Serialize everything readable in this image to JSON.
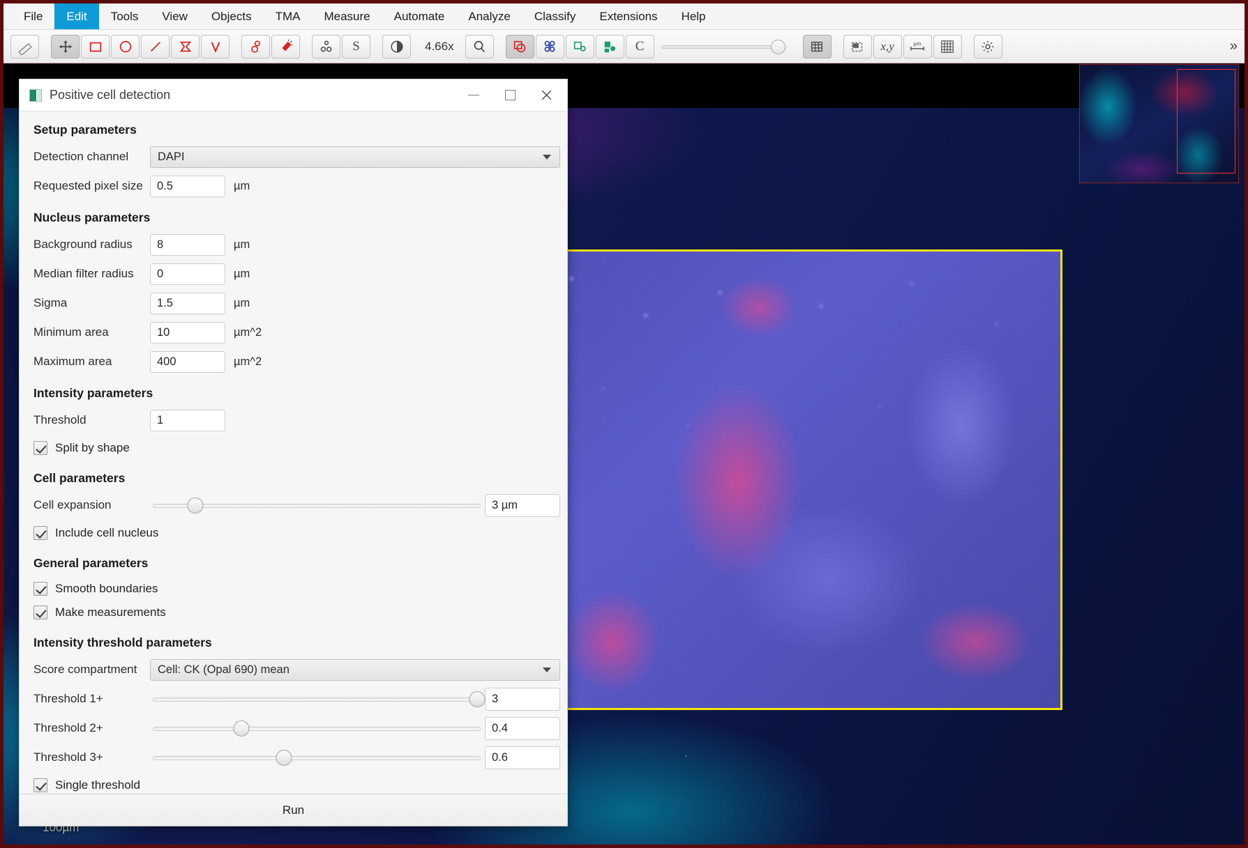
{
  "menubar": {
    "items": [
      {
        "label": "File",
        "active": false
      },
      {
        "label": "Edit",
        "active": true
      },
      {
        "label": "Tools",
        "active": false
      },
      {
        "label": "View",
        "active": false
      },
      {
        "label": "Objects",
        "active": false
      },
      {
        "label": "TMA",
        "active": false
      },
      {
        "label": "Measure",
        "active": false
      },
      {
        "label": "Automate",
        "active": false
      },
      {
        "label": "Analyze",
        "active": false
      },
      {
        "label": "Classify",
        "active": false
      },
      {
        "label": "Extensions",
        "active": false
      },
      {
        "label": "Help",
        "active": false
      }
    ]
  },
  "toolbar": {
    "zoom_label": "4.66x",
    "overflow_label": "»",
    "buttons": [
      {
        "name": "ruler-icon",
        "title": "Measure / ruler"
      },
      {
        "name": "move-tool-icon",
        "title": "Move tool"
      },
      {
        "name": "rectangle-tool-icon",
        "title": "Rectangle"
      },
      {
        "name": "ellipse-tool-icon",
        "title": "Ellipse"
      },
      {
        "name": "line-tool-icon",
        "title": "Line"
      },
      {
        "name": "polygon-tool-icon",
        "title": "Polygon"
      },
      {
        "name": "polyline-tool-icon",
        "title": "Polyline"
      },
      {
        "name": "brush-tool-icon",
        "title": "Brush"
      },
      {
        "name": "wand-tool-icon",
        "title": "Wand"
      },
      {
        "name": "points-tool-icon",
        "title": "Points"
      },
      {
        "name": "selection-mode-icon",
        "title": "S selection mode"
      },
      {
        "name": "brightness-contrast-icon",
        "title": "Brightness/contrast"
      },
      {
        "name": "magnifier-icon",
        "title": "Zoom to fit"
      },
      {
        "name": "show-annotations-icon",
        "title": "Show annotations"
      },
      {
        "name": "show-detections-icon",
        "title": "Show detections"
      },
      {
        "name": "fill-annotations-icon",
        "title": "Fill annotations"
      },
      {
        "name": "fill-detections-icon",
        "title": "Fill detections"
      },
      {
        "name": "show-classification-icon",
        "title": "Show classification"
      },
      {
        "name": "grid-icon",
        "title": "Show grid"
      },
      {
        "name": "overview-icon",
        "title": "Show overview"
      },
      {
        "name": "location-icon",
        "title": "Show location"
      },
      {
        "name": "scalebar-icon",
        "title": "Show scalebar"
      },
      {
        "name": "counting-grid-icon",
        "title": "Show counting grid"
      },
      {
        "name": "preferences-icon",
        "title": "Preferences"
      }
    ]
  },
  "dialog": {
    "title": "Positive cell detection",
    "window_controls": {
      "minimize": "—",
      "maximize": "☐",
      "close": "✕"
    },
    "sections": {
      "setup": {
        "title": "Setup parameters",
        "detection_channel": {
          "label": "Detection channel",
          "value": "DAPI"
        },
        "requested_pixel_size": {
          "label": "Requested pixel size",
          "value": "0.5",
          "unit": "µm"
        }
      },
      "nucleus": {
        "title": "Nucleus parameters",
        "fields": [
          {
            "label": "Background radius",
            "value": "8",
            "unit": "µm"
          },
          {
            "label": "Median filter radius",
            "value": "0",
            "unit": "µm"
          },
          {
            "label": "Sigma",
            "value": "1.5",
            "unit": "µm"
          },
          {
            "label": "Minimum area",
            "value": "10",
            "unit": "µm^2"
          },
          {
            "label": "Maximum area",
            "value": "400",
            "unit": "µm^2"
          }
        ]
      },
      "intensity": {
        "title": "Intensity parameters",
        "threshold": {
          "label": "Threshold",
          "value": "1"
        },
        "split_by_shape": {
          "label": "Split by shape",
          "checked": true
        }
      },
      "cell": {
        "title": "Cell parameters",
        "cell_expansion": {
          "label": "Cell expansion",
          "value": "3 µm",
          "slider_percent": 13
        },
        "include_cell_nucleus": {
          "label": "Include cell nucleus",
          "checked": true
        }
      },
      "general": {
        "title": "General parameters",
        "smooth_boundaries": {
          "label": "Smooth boundaries",
          "checked": true
        },
        "make_measurements": {
          "label": "Make measurements",
          "checked": true
        }
      },
      "intensity_threshold": {
        "title": "Intensity threshold parameters",
        "score_compartment": {
          "label": "Score compartment",
          "value": "Cell: CK (Opal 690) mean"
        },
        "thresholds": [
          {
            "label": "Threshold 1+",
            "value": "3",
            "slider_percent": 99
          },
          {
            "label": "Threshold 2+",
            "value": "0.4",
            "slider_percent": 27
          },
          {
            "label": "Threshold 3+",
            "value": "0.6",
            "slider_percent": 40
          }
        ],
        "single_threshold": {
          "label": "Single threshold",
          "checked": true
        }
      }
    },
    "run_button": "Run"
  },
  "viewer": {
    "scalebar_label": "100µm",
    "annotation_color": "#f7e400",
    "overview_viewport_color": "#ff3030"
  }
}
